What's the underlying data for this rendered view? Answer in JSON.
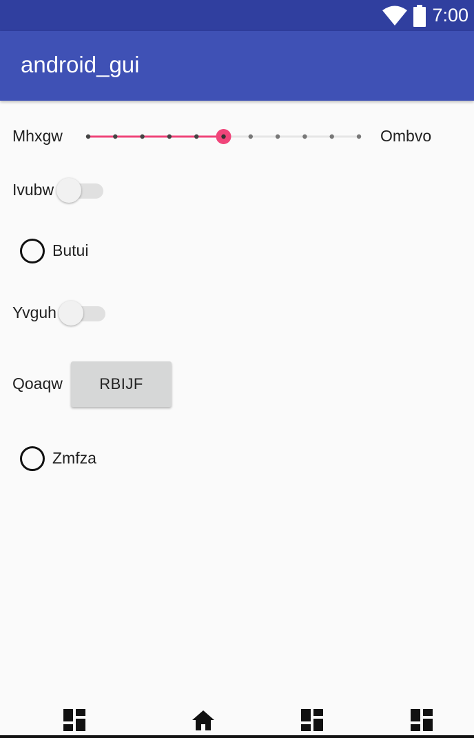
{
  "status_bar": {
    "time": "7:00",
    "icons": [
      "wifi-icon",
      "battery-icon"
    ]
  },
  "app_bar": {
    "title": "android_gui"
  },
  "seekbar": {
    "start_label": "Mhxgw",
    "end_label": "Ombvo",
    "steps": 10,
    "value": 5,
    "accent": "#f0457a"
  },
  "switches": [
    {
      "label": "Ivubw",
      "checked": false
    },
    {
      "label": "Yvguh",
      "checked": false
    }
  ],
  "radios": [
    {
      "label": "Butui",
      "checked": false
    },
    {
      "label": "Zmfza",
      "checked": false
    }
  ],
  "button_row": {
    "label": "Qoaqw",
    "button_label": "RBIJF"
  },
  "nav_bar": {
    "icons": [
      "dashboard-icon",
      "home-icon",
      "dashboard-icon",
      "dashboard-icon"
    ]
  },
  "colors": {
    "primary": "#3f51b5",
    "primary_dark": "#303f9f",
    "accent": "#f0457a",
    "background": "#fafafa"
  }
}
